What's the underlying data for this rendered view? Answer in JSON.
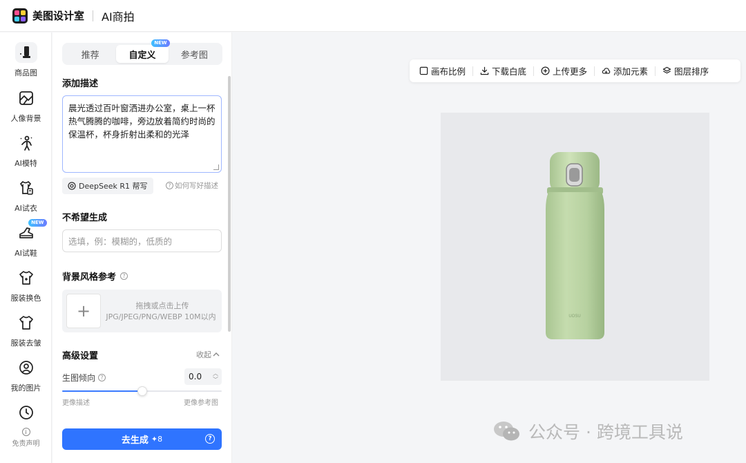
{
  "app": {
    "brand": "美图设计室",
    "product": "AI商拍",
    "logo_colors": [
      "#ff4d8f",
      "#ffcf33",
      "#3fd1ff",
      "#8b5cff"
    ]
  },
  "leftnav": {
    "items": [
      {
        "label": "商品图",
        "icon": "product-image-icon",
        "active": true
      },
      {
        "label": "人像背景",
        "icon": "portrait-background-icon"
      },
      {
        "label": "AI模特",
        "icon": "ai-model-icon"
      },
      {
        "label": "AI试衣",
        "icon": "ai-tryon-clothes-icon"
      },
      {
        "label": "AI试鞋",
        "icon": "ai-tryon-shoes-icon",
        "badge": "NEW"
      },
      {
        "label": "服装换色",
        "icon": "clothing-recolor-icon"
      },
      {
        "label": "服装去皱",
        "icon": "clothing-dewrinkle-icon"
      },
      {
        "label": "我的图片",
        "icon": "my-images-icon"
      },
      {
        "label": "",
        "icon": "history-clock-icon"
      }
    ],
    "disclaimer": "免责声明"
  },
  "panel": {
    "tabs": [
      {
        "label": "推荐"
      },
      {
        "label": "自定义",
        "badge": "NEW",
        "active": true
      },
      {
        "label": "参考图"
      }
    ],
    "describe": {
      "title": "添加描述",
      "value": "晨光透过百叶窗洒进办公室，桌上一杯热气腾腾的咖啡，旁边放着简约时尚的保温杯，杯身折射出柔和的光泽",
      "deepseek_label": "DeepSeek R1 帮写",
      "howto_label": "如何写好描述"
    },
    "negative": {
      "title": "不希望生成",
      "placeholder": "选填，例：模糊的，低质的"
    },
    "bg_reference": {
      "title": "背景风格参考",
      "upload_line1": "拖拽或点击上传",
      "upload_line2": "JPG/JPEG/PNG/WEBP 10M以内"
    },
    "advanced": {
      "title": "高级设置",
      "collapse_label": "收起",
      "bias_label": "生图倾向",
      "bias_value": "0.0",
      "bias_fraction": 0.5,
      "left_label": "更像描述",
      "right_label": "更像参考图"
    },
    "generate": {
      "label": "去生成",
      "cost": "8"
    }
  },
  "toolbar": {
    "items": [
      {
        "label": "画布比例",
        "icon": "canvas-ratio-icon"
      },
      {
        "label": "下载白底",
        "icon": "download-icon"
      },
      {
        "label": "上传更多",
        "icon": "upload-plus-icon"
      },
      {
        "label": "添加元素",
        "icon": "add-element-icon"
      },
      {
        "label": "图层排序",
        "icon": "layers-icon"
      }
    ]
  },
  "canvas": {
    "product_name": "thermos bottle",
    "bottle_color": "#b8d3a0"
  },
  "watermark": "公众号 · 跨境工具说"
}
